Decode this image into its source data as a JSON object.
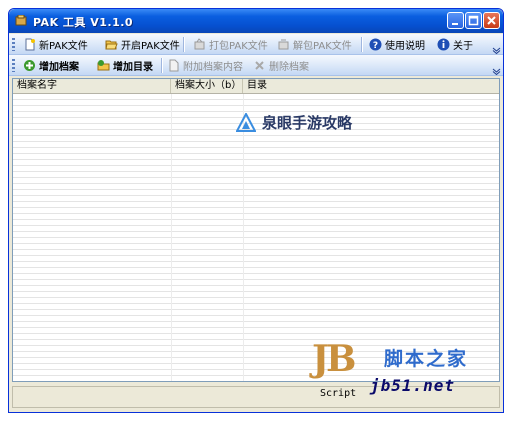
{
  "window": {
    "title": "PAK 工具 V1.1.0"
  },
  "toolbar1": {
    "new_pak": "新PAK文件",
    "open_pak": "开启PAK文件",
    "pack_pak": "打包PAK文件",
    "unpack_pak": "解包PAK文件",
    "help": "使用说明",
    "about": "关于"
  },
  "toolbar2": {
    "add_file": "增加档案",
    "add_dir": "增加目录",
    "append_content": "附加档案内容",
    "delete_file": "删除档案"
  },
  "list": {
    "columns": [
      "档案名字",
      "档案大小（b）",
      "目录"
    ]
  },
  "watermarks": {
    "center": "泉眼手游攻略",
    "logo": "JB",
    "script": "Script",
    "site_name": "脚本之家",
    "url": "jb51.net"
  }
}
